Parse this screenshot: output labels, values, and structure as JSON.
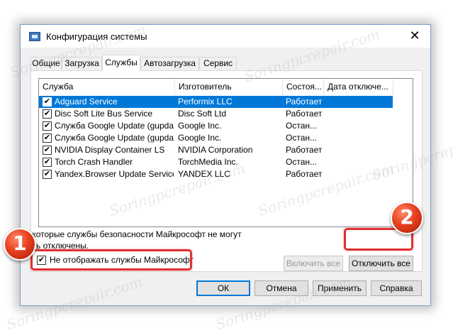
{
  "watermark": "Soringpcrepair.com",
  "window": {
    "title": "Конфигурация системы",
    "icon": "msconfig-icon",
    "close_glyph": "✕"
  },
  "tabs": [
    {
      "label": "Общие",
      "active": false
    },
    {
      "label": "Загрузка",
      "active": false
    },
    {
      "label": "Службы",
      "active": true
    },
    {
      "label": "Автозагрузка",
      "active": false
    },
    {
      "label": "Сервис",
      "active": false
    }
  ],
  "services": {
    "columns": [
      "Служба",
      "Изготовитель",
      "Состоя...",
      "Дата отключе..."
    ],
    "rows": [
      {
        "service": "Adguard Service",
        "maker": "Performix LLC",
        "status": "Работает",
        "checked": true,
        "selected": true
      },
      {
        "service": "Disc Soft Lite Bus Service",
        "maker": "Disc Soft Ltd",
        "status": "Работает",
        "checked": true,
        "selected": false
      },
      {
        "service": "Служба Google Update (gupdate)",
        "maker": "Google Inc.",
        "status": "Остан...",
        "checked": true,
        "selected": false
      },
      {
        "service": "Служба Google Update (gupdate...",
        "maker": "Google Inc.",
        "status": "Остан...",
        "checked": true,
        "selected": false
      },
      {
        "service": "NVIDIA Display Container LS",
        "maker": "NVIDIA Corporation",
        "status": "Работает",
        "checked": true,
        "selected": false
      },
      {
        "service": "Torch Crash Handler",
        "maker": "TorchMedia Inc.",
        "status": "Остан...",
        "checked": true,
        "selected": false
      },
      {
        "service": "Yandex.Browser Update Service",
        "maker": "YANDEX LLC",
        "status": "Работает",
        "checked": true,
        "selected": false
      }
    ]
  },
  "note": "Некоторые службы безопасности Майкрософт не могут быть отключены.",
  "buttons": {
    "enable_all": "Включить все",
    "disable_all": "Отключить все",
    "ok": "ОК",
    "cancel": "Отмена",
    "apply": "Применить",
    "help": "Справка"
  },
  "hide_ms": {
    "label": "Не отображать службы Майкрософт",
    "checked": true
  },
  "badges": {
    "one": "1",
    "two": "2"
  },
  "colors": {
    "selection": "#0078d7",
    "highlight": "#e03030",
    "badge": "#e8401f"
  }
}
